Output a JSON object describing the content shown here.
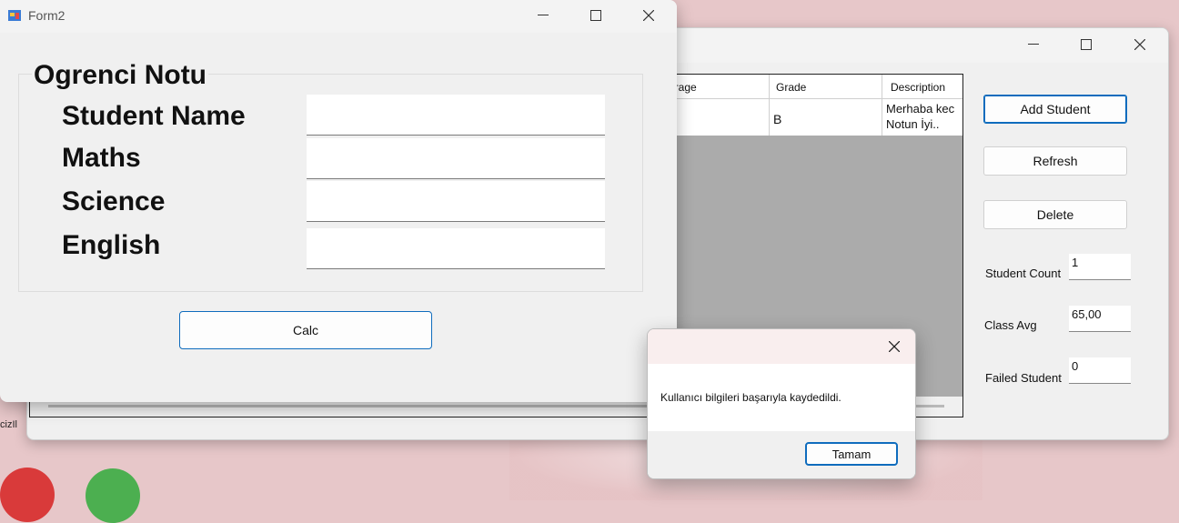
{
  "form1": {
    "grid": {
      "columns": [
        "erage",
        "Grade",
        "Description"
      ],
      "rows": [
        {
          "grade": "B",
          "description_line1": "Merhaba kec",
          "description_line2": "Notun İyi.."
        }
      ]
    },
    "buttons": {
      "add": "Add Student",
      "refresh": "Refresh",
      "delete": "Delete"
    },
    "stats": {
      "count_label": "Student Count",
      "count_value": "1",
      "avg_label": "Class Avg",
      "avg_value": "65,00",
      "failed_label": "Failed Student",
      "failed_value": "0"
    }
  },
  "form2": {
    "title": "Form2",
    "group_title": "Ogrenci Notu",
    "fields": {
      "name": "Student Name",
      "maths": "Maths",
      "science": "Science",
      "english": "English"
    },
    "calc_label": "Calc"
  },
  "messagebox": {
    "text": "Kullanıcı bilgileri başarıyla kaydedildi.",
    "ok_label": "Tamam"
  },
  "desktop": {
    "partial_label": "cizIl"
  },
  "colors": {
    "accent": "#0f6cbd",
    "grid_bg": "#ababab",
    "desktop_bg": "#e7c7c9"
  },
  "icons": [
    "minimize-icon",
    "maximize-icon",
    "close-icon",
    "app-icon"
  ]
}
